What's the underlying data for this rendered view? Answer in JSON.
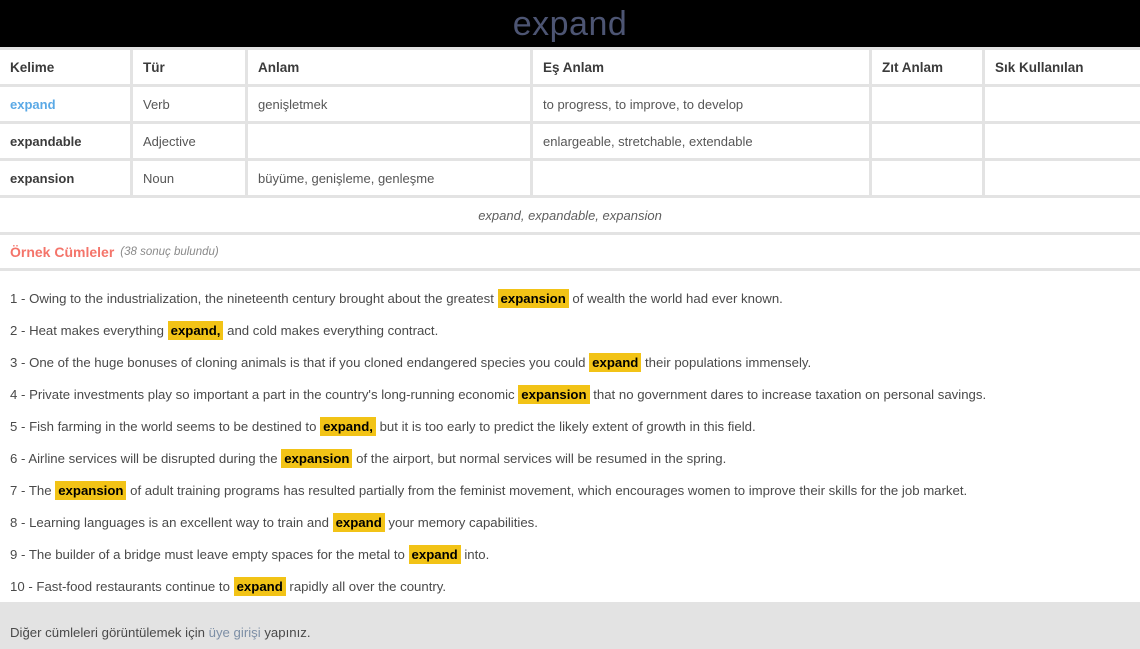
{
  "header": {
    "title": "expand"
  },
  "table": {
    "columns": [
      "Kelime",
      "Tür",
      "Anlam",
      "Eş Anlam",
      "Zıt Anlam",
      "Sık Kullanılan"
    ],
    "rows": [
      {
        "kelime": "expand",
        "kelime_is_link": true,
        "tur": "Verb",
        "anlam": "genişletmek",
        "es_anlam": "to progress, to improve, to develop",
        "zit_anlam": "",
        "sik_kullanilan": ""
      },
      {
        "kelime": "expandable",
        "kelime_is_link": false,
        "tur": "Adjective",
        "anlam": "",
        "es_anlam": "enlargeable, stretchable, extendable",
        "zit_anlam": "",
        "sik_kullanilan": ""
      },
      {
        "kelime": "expansion",
        "kelime_is_link": false,
        "tur": "Noun",
        "anlam": "büyüme, genişleme, genleşme",
        "es_anlam": "",
        "zit_anlam": "",
        "sik_kullanilan": ""
      }
    ]
  },
  "forms_strip": {
    "text": "expand, expandable, expansion"
  },
  "examples": {
    "title": "Örnek Cümleler",
    "count_label": "(38 sonuç bulundu)",
    "sentences": [
      {
        "number": "1 - ",
        "pre": "Owing to the industrialization, the nineteenth century brought about the greatest ",
        "highlight": "expansion",
        "post": " of wealth the world had ever known."
      },
      {
        "number": "2 - ",
        "pre": "Heat makes everything ",
        "highlight": "expand,",
        "post": " and cold makes everything contract."
      },
      {
        "number": "3 - ",
        "pre": "One of the huge bonuses of cloning animals is that if you cloned endangered species you could ",
        "highlight": "expand",
        "post": " their populations immensely."
      },
      {
        "number": "4 - ",
        "pre": "Private investments play so important a part in the country's long-running economic ",
        "highlight": "expansion",
        "post": " that no government dares to increase taxation on personal savings."
      },
      {
        "number": "5 - ",
        "pre": "Fish farming in the world seems to be destined to ",
        "highlight": "expand,",
        "post": " but it is too early to predict the likely extent of growth in this field."
      },
      {
        "number": "6 - ",
        "pre": "Airline services will be disrupted during the ",
        "highlight": "expansion",
        "post": " of the airport, but normal services will be resumed in the spring."
      },
      {
        "number": "7 - ",
        "pre": "The ",
        "highlight": "expansion",
        "post": " of adult training programs has resulted partially from the feminist movement, which encourages women to improve their skills for the job market."
      },
      {
        "number": "8 - ",
        "pre": "Learning languages is an excellent way to train and ",
        "highlight": "expand",
        "post": " your memory capabilities."
      },
      {
        "number": "9 - ",
        "pre": "The builder of a bridge must leave empty spaces for the metal to ",
        "highlight": "expand",
        "post": " into."
      },
      {
        "number": "10 - ",
        "pre": "Fast-food restaurants continue to ",
        "highlight": "expand",
        "post": " rapidly all over the country."
      }
    ],
    "footer": {
      "pre": "Diğer cümleleri görüntülemek için ",
      "link": "üye girişi",
      "post": " yapınız."
    }
  },
  "colors": {
    "header_bg": "#000000",
    "header_text": "#4d5573",
    "word_link": "#5aa9e6",
    "highlight_bg": "#f2c316",
    "examples_title": "#f4746a",
    "login_link": "#7d8fa6",
    "page_bg": "#e3e3e3"
  }
}
